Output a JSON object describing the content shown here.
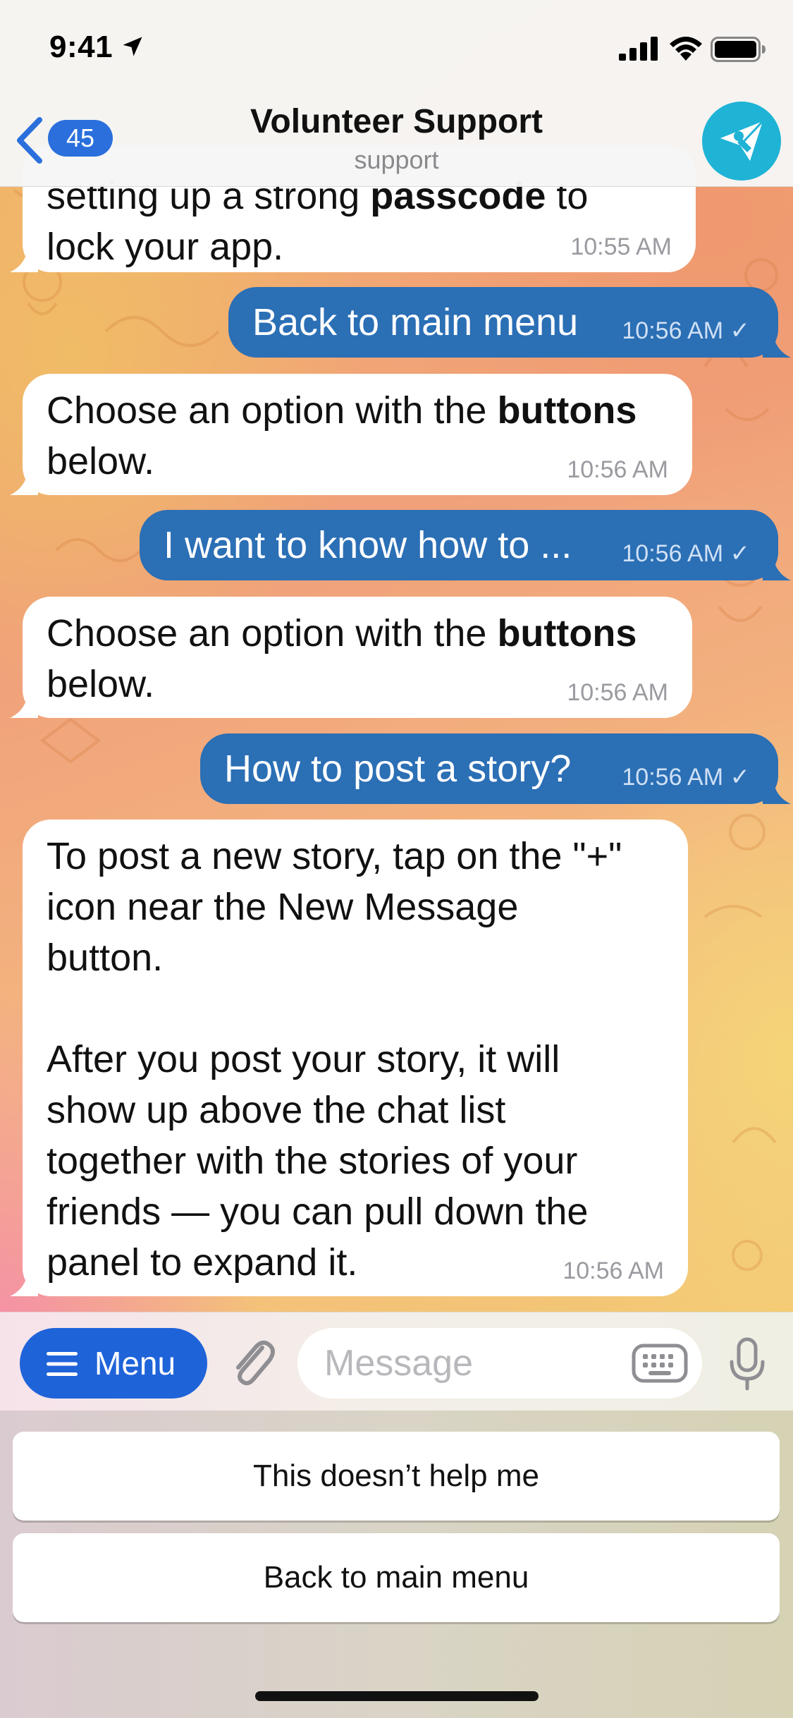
{
  "status_bar": {
    "time": "9:41"
  },
  "header": {
    "back_count": "45",
    "title": "Volunteer Support",
    "subtitle": "support"
  },
  "messages": [
    {
      "direction": "in",
      "text_pre": "setting up a strong ",
      "text_bold": "passcode",
      "text_post": " to\nlock your app.",
      "time": "10:55 AM"
    },
    {
      "direction": "out",
      "text": "Back to main menu",
      "time": "10:56 AM"
    },
    {
      "direction": "in",
      "text_pre": "Choose an option with the ",
      "text_bold": "buttons",
      "text_post": "\nbelow.",
      "time": "10:56 AM"
    },
    {
      "direction": "out",
      "text": "I want to know how to ...",
      "time": "10:56 AM"
    },
    {
      "direction": "in",
      "text_pre": "Choose an option with the ",
      "text_bold": "buttons",
      "text_post": "\nbelow.",
      "time": "10:56 AM"
    },
    {
      "direction": "out",
      "text": "How to post a story?",
      "time": "10:56 AM"
    },
    {
      "direction": "in",
      "text": "To post a new story, tap on the \"+\"\nicon near the New Message\nbutton.\n\nAfter you post your story, it will\nshow up above the chat list\ntogether with the stories of your\nfriends — you can pull down the\npanel to expand it.",
      "time": "10:56 AM"
    }
  ],
  "input_bar": {
    "menu_label": "Menu",
    "placeholder": "Message"
  },
  "keyboard_buttons": [
    "This doesn’t help me",
    "Back to main menu"
  ],
  "colors": {
    "outgoing_bubble": "#2b6fb5",
    "incoming_bubble": "#ffffff",
    "accent": "#1f63d9",
    "avatar": "#1fb3d6"
  }
}
